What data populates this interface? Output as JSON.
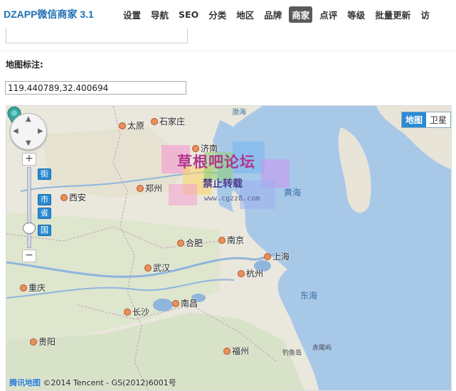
{
  "header": {
    "brand": "DZAPP微信商家 3.1",
    "nav": [
      {
        "label": "设置"
      },
      {
        "label": "导航"
      },
      {
        "label": "SEO"
      },
      {
        "label": "分类"
      },
      {
        "label": "地区"
      },
      {
        "label": "品牌"
      },
      {
        "label": "商家",
        "active": true
      },
      {
        "label": "点评"
      },
      {
        "label": "等级"
      },
      {
        "label": "批量更新"
      },
      {
        "label": "访"
      }
    ]
  },
  "form": {
    "map_label": "地图标注:",
    "coordinates": "119.440789,32.400694"
  },
  "map": {
    "type_buttons": [
      "地图",
      "卫星"
    ],
    "zoom_levels": [
      "街",
      "市",
      "省",
      "国"
    ],
    "zoom_in": "+",
    "zoom_out": "−",
    "cities": [
      "太原",
      "石家庄",
      "济南",
      "郑州",
      "西安",
      "合肥",
      "南京",
      "上海",
      "武汉",
      "杭州",
      "重庆",
      "长沙",
      "南昌",
      "福州",
      "贵阳"
    ],
    "seas": [
      "渤海",
      "黄海",
      "东海"
    ],
    "small_labels": [
      "钓鱼岛",
      "赤尾屿"
    ],
    "watermark": {
      "title": "草根吧论坛",
      "subtitle": "禁止转载",
      "url": "www.cgzz8.com"
    },
    "copyright_logo": "腾讯地图",
    "copyright_text": "©2014 Tencent - GS(2012)6001号"
  }
}
